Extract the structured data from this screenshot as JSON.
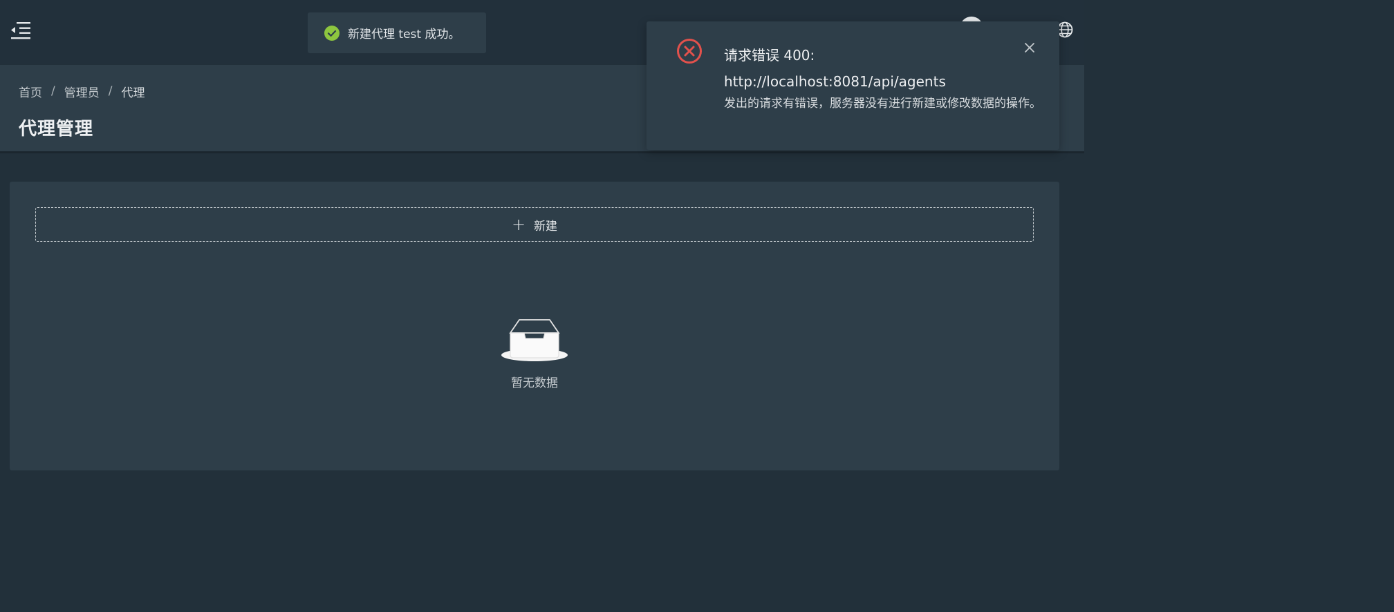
{
  "breadcrumb": {
    "items": [
      "首页",
      "管理员",
      "代理"
    ],
    "separator": "/"
  },
  "page": {
    "title": "代理管理"
  },
  "list": {
    "add_label": "新建",
    "empty_text": "暂无数据"
  },
  "toast": {
    "message": "新建代理 test 成功。",
    "status": "success",
    "icon": "check-circle-icon",
    "color": "#8dc63f"
  },
  "notification": {
    "status": "error",
    "icon": "close-circle-icon",
    "color": "#e2514c",
    "title": "请求错误 400: http://localhost:8081/api/agents",
    "description": "发出的请求有错误，服务器没有进行新建或修改数据的操作。"
  },
  "icons": {
    "menu": "menu-fold-icon",
    "language": "globe-icon",
    "user": "avatar"
  },
  "colors": {
    "topbar_bg": "#22303b",
    "panel_bg": "#2e3e49",
    "page_bg": "#22303a"
  }
}
